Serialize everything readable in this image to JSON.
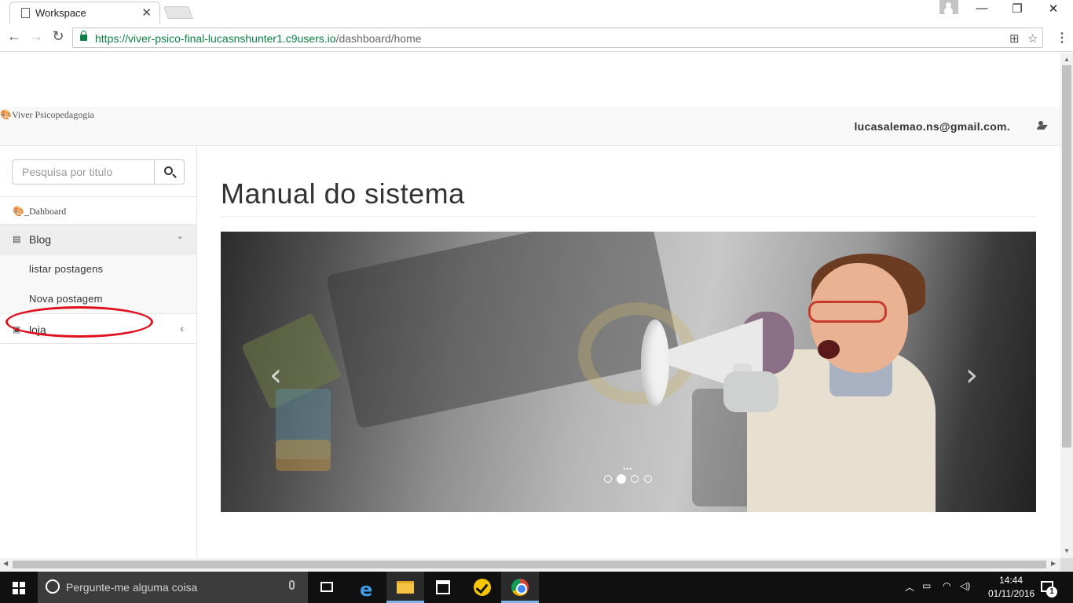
{
  "browser": {
    "tab_title": "Workspace",
    "tab_close": "✕",
    "url_host": "https://viver-psico-final-lucasnshunter1.c9users.io",
    "url_path": "/dashboard/home",
    "back": "←",
    "forward": "→",
    "reload": "↻",
    "translate": "⊞",
    "star": "☆",
    "menu": "⋮",
    "minimize": "—",
    "maximize": "❐",
    "close": "✕"
  },
  "navbar": {
    "brand": "Viver Psicopedagogia",
    "user_email": "lucasalemao.ns@gmail.com."
  },
  "sidebar": {
    "search_placeholder": "Pesquisa por titulo",
    "dashboard_label": "_Dahboard",
    "blog_label": "Blog",
    "blog_sub_items": [
      "listar postagens",
      "Nova postagem"
    ],
    "loja_label": "loja",
    "expanded_chevron": "⌄",
    "collapsed_chevron": "‹"
  },
  "main": {
    "title": "Manual do sistema",
    "carousel": {
      "caption": "...",
      "prev": "‹",
      "next": "›",
      "indicator_count": 4,
      "active_index": 1
    }
  },
  "taskbar": {
    "search_text": "Pergunte-me alguma coisa",
    "time": "14:44",
    "date": "01/11/2016",
    "notification_count": "1"
  },
  "colors": {
    "highlight_oval": "#e0101f",
    "secure_url": "#0b8043",
    "navbar_bg": "#f8f8f8"
  }
}
